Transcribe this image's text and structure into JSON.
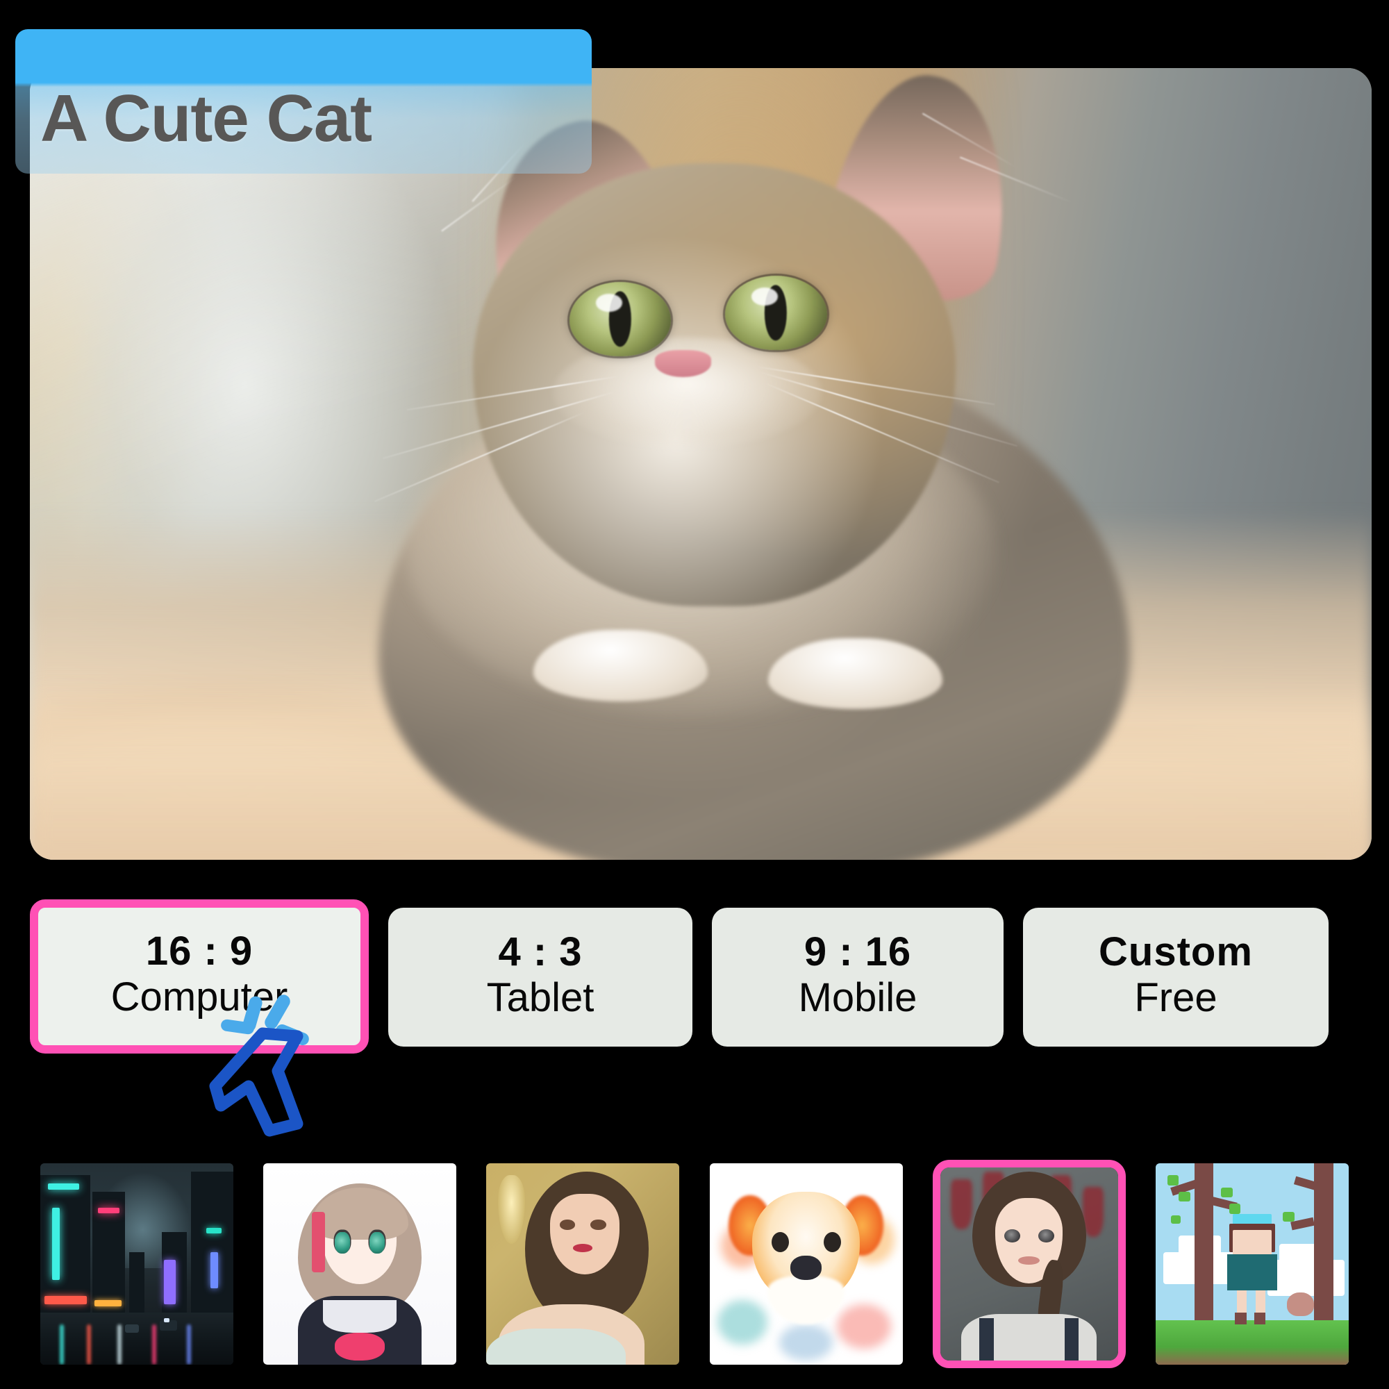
{
  "app": {
    "title": "A Cute Cat",
    "accent_pink": "#ff51b5",
    "accent_blue": "#3fb4f5",
    "button_bg": "#e6eae5",
    "title_text_color": "#585756",
    "cursor_color": "#1b55c6",
    "spark_color": "#4aaaea"
  },
  "preview": {
    "name": "main-preview-image",
    "subject": "fluffy tabby kitten lying on a blanket",
    "alt": "A Cute Cat"
  },
  "ratio_options": [
    {
      "ratio": "16 : 9",
      "device": "Computer",
      "selected": true
    },
    {
      "ratio": "4 : 3",
      "device": "Tablet",
      "selected": false
    },
    {
      "ratio": "9 : 16",
      "device": "Mobile",
      "selected": false
    },
    {
      "ratio": "Custom",
      "device": "Free",
      "selected": false
    }
  ],
  "thumbnails": [
    {
      "name": "thumbnail-cyberpunk-city",
      "caption": "cyberpunk city street at night",
      "selected": false
    },
    {
      "name": "thumbnail-anime-schoolgirl",
      "caption": "anime schoolgirl portrait",
      "selected": false
    },
    {
      "name": "thumbnail-painted-woman",
      "caption": "painted portrait of a woman",
      "selected": false
    },
    {
      "name": "thumbnail-watercolor-dog",
      "caption": "watercolor dog portrait",
      "selected": false
    },
    {
      "name": "thumbnail-3d-girl-braid",
      "caption": "3d render girl with braid",
      "selected": true
    },
    {
      "name": "thumbnail-pixel-forest",
      "caption": "pixel art girl in forest",
      "selected": false
    }
  ],
  "cursor": {
    "name": "mouse-pointer",
    "state": "clicked",
    "target": "16 : 9 Computer"
  }
}
